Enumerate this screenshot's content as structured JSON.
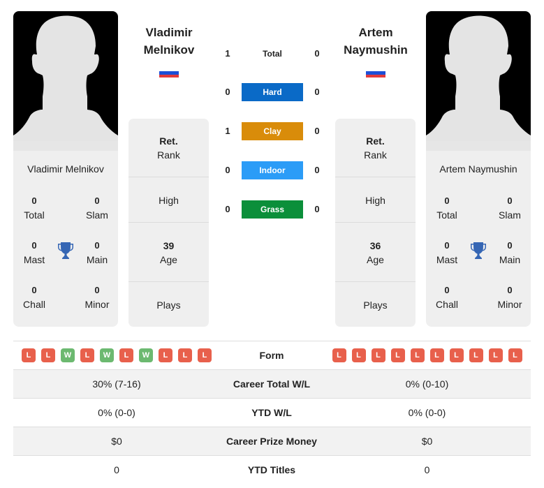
{
  "colors": {
    "hard": "#0a6ac7",
    "clay": "#d98c0a",
    "indoor": "#2b9cf7",
    "grass": "#0b8f3a",
    "loss": "#e8604c",
    "win": "#6cb970",
    "trophy": "#3566b4"
  },
  "left_player": {
    "name": "Vladimir Melnikov",
    "name_line1": "Vladimir",
    "name_line2": "Melnikov",
    "flag": "Russia",
    "titles": {
      "total": {
        "value": "0",
        "label": "Total"
      },
      "slam": {
        "value": "0",
        "label": "Slam"
      },
      "mast": {
        "value": "0",
        "label": "Mast"
      },
      "main": {
        "value": "0",
        "label": "Main"
      },
      "chall": {
        "value": "0",
        "label": "Chall"
      },
      "minor": {
        "value": "0",
        "label": "Minor"
      }
    },
    "info": {
      "rank_value": "Ret.",
      "rank_label": "Rank",
      "high_label": "High",
      "age_value": "39",
      "age_label": "Age",
      "plays_label": "Plays"
    },
    "form": [
      "L",
      "L",
      "W",
      "L",
      "W",
      "L",
      "W",
      "L",
      "L",
      "L"
    ]
  },
  "right_player": {
    "name": "Artem Naymushin",
    "name_line1": "Artem",
    "name_line2": "Naymushin",
    "flag": "Russia",
    "titles": {
      "total": {
        "value": "0",
        "label": "Total"
      },
      "slam": {
        "value": "0",
        "label": "Slam"
      },
      "mast": {
        "value": "0",
        "label": "Mast"
      },
      "main": {
        "value": "0",
        "label": "Main"
      },
      "chall": {
        "value": "0",
        "label": "Chall"
      },
      "minor": {
        "value": "0",
        "label": "Minor"
      }
    },
    "info": {
      "rank_value": "Ret.",
      "rank_label": "Rank",
      "high_label": "High",
      "age_value": "36",
      "age_label": "Age",
      "plays_label": "Plays"
    },
    "form": [
      "L",
      "L",
      "L",
      "L",
      "L",
      "L",
      "L",
      "L",
      "L",
      "L"
    ]
  },
  "h2h": [
    {
      "label": "Total",
      "left": "1",
      "right": "0"
    },
    {
      "label": "Hard",
      "left": "0",
      "right": "0"
    },
    {
      "label": "Clay",
      "left": "1",
      "right": "0"
    },
    {
      "label": "Indoor",
      "left": "0",
      "right": "0"
    },
    {
      "label": "Grass",
      "left": "0",
      "right": "0"
    }
  ],
  "stats": {
    "form_label": "Form",
    "rows": [
      {
        "label": "Career Total W/L",
        "left": "30% (7-16)",
        "right": "0% (0-10)"
      },
      {
        "label": "YTD W/L",
        "left": "0% (0-0)",
        "right": "0% (0-0)"
      },
      {
        "label": "Career Prize Money",
        "left": "$0",
        "right": "$0"
      },
      {
        "label": "YTD Titles",
        "left": "0",
        "right": "0"
      }
    ]
  }
}
